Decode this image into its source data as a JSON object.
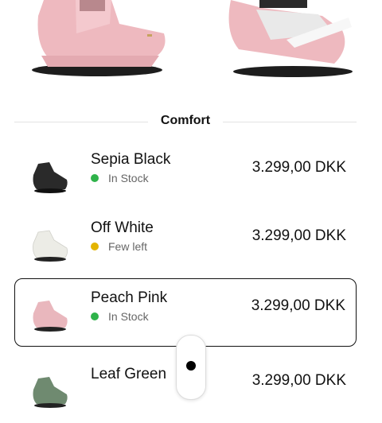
{
  "section": {
    "title": "Comfort"
  },
  "products": [
    {
      "name": "Sepia Black",
      "stock": "In Stock",
      "stock_color": "#2fb34a",
      "price": "3.299,00 DKK",
      "swatch": "#2a2a2a",
      "selected": false
    },
    {
      "name": "Off White",
      "stock": "Few left",
      "stock_color": "#e3b400",
      "price": "3.299,00 DKK",
      "swatch": "#ecece6",
      "selected": false
    },
    {
      "name": "Peach Pink",
      "stock": "In Stock",
      "stock_color": "#2fb34a",
      "price": "3.299,00 DKK",
      "swatch": "#e9b7bd",
      "selected": true
    },
    {
      "name": "Leaf Green",
      "stock": "",
      "stock_color": "#2fb34a",
      "price": "3.299,00 DKK",
      "swatch": "#6f8a70",
      "selected": false
    }
  ],
  "colors": {
    "accent": "#111111",
    "in_stock": "#2fb34a",
    "few_left": "#e3b400"
  }
}
